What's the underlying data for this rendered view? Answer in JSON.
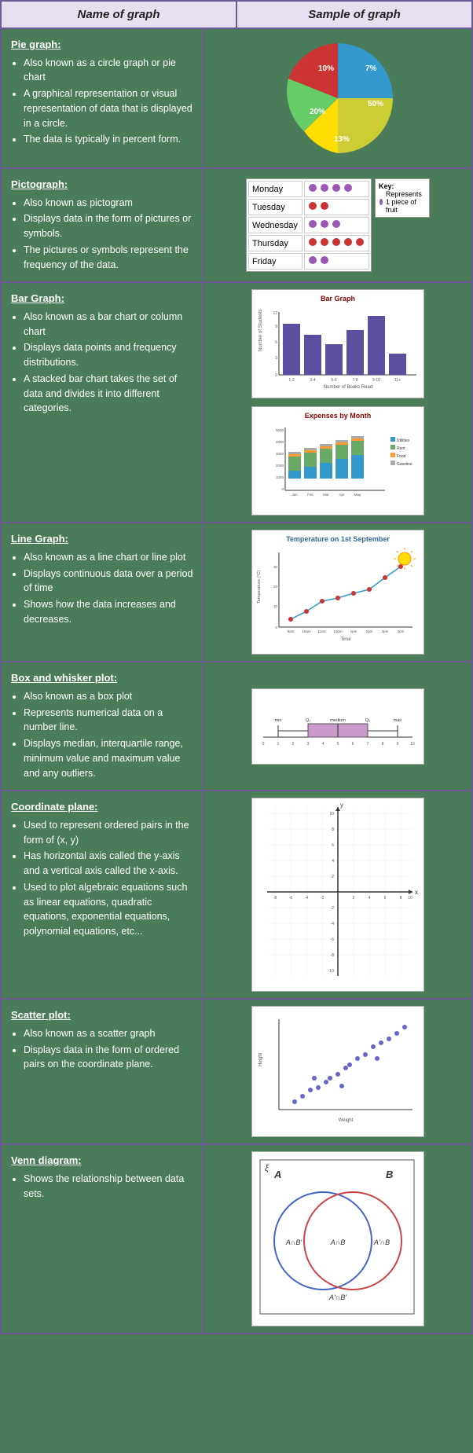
{
  "header": {
    "col1": "Name of graph",
    "col2": "Sample of graph"
  },
  "rows": [
    {
      "id": "pie",
      "title": "Pie graph:",
      "bullets": [
        "Also known as a circle graph or pie chart",
        "A graphical representation or visual representation of data that is displayed in a circle.",
        "The data is typically in percent form."
      ]
    },
    {
      "id": "pictograph",
      "title": "Pictograph:",
      "bullets": [
        "Also known as pictogram",
        "Displays data in the form of pictures or symbols.",
        "The pictures or symbols represent the frequency of the data."
      ]
    },
    {
      "id": "bar",
      "title": "Bar Graph:",
      "bullets": [
        "Also known as a bar chart or column chart",
        "Displays data points and frequency distributions.",
        "A stacked bar chart takes the set of data and divides it into different categories."
      ]
    },
    {
      "id": "line",
      "title": "Line Graph:",
      "bullets": [
        "Also known as a line chart or line plot",
        "Displays continuous data over a period of time",
        "Shows how the data increases and decreases."
      ]
    },
    {
      "id": "boxwhisker",
      "title": "Box and whisker plot:",
      "bullets": [
        "Also known as a box plot",
        "Represents numerical data on a number line.",
        "Displays median, interquartile range, minimum value and maximum value and any outliers."
      ]
    },
    {
      "id": "coordinate",
      "title": "Coordinate plane:",
      "bullets": [
        "Used to represent ordered pairs in the form of (x, y)",
        "Has horizontal axis called the y-axis and a vertical axis called the x-axis.",
        "Used to plot algebraic equations such as linear equations, quadratic equations, exponential equations, polynomial equations, etc..."
      ]
    },
    {
      "id": "scatter",
      "title": "Scatter plot:",
      "bullets": [
        "Also known as a scatter graph",
        "Displays data in the form of ordered pairs on the coordinate plane."
      ]
    },
    {
      "id": "venn",
      "title": "Venn diagram:",
      "bullets": [
        "Shows the relationship between data sets."
      ]
    }
  ]
}
